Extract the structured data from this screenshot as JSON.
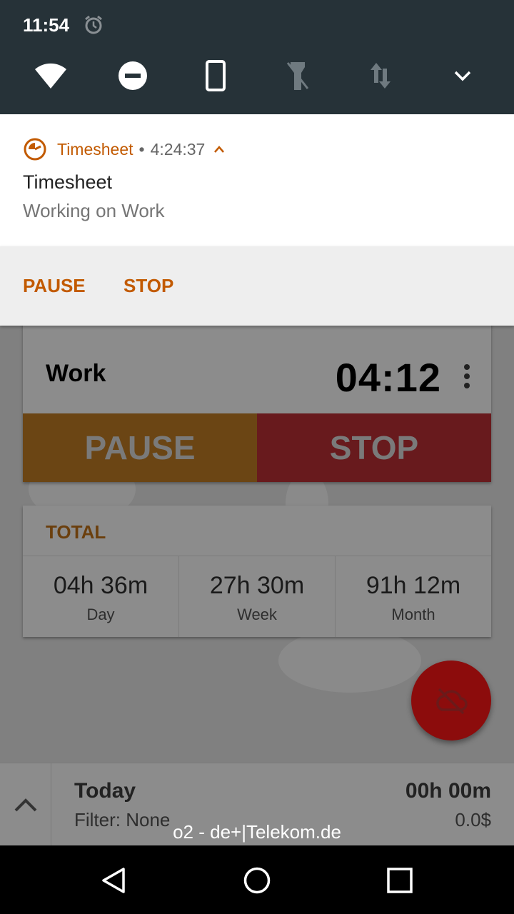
{
  "status_bar": {
    "time": "11:54",
    "icons": [
      "alarm-icon"
    ]
  },
  "quick_settings": {
    "tiles": [
      "wifi-icon",
      "do-not-disturb-icon",
      "auto-rotate-icon",
      "flashlight-off-icon",
      "data-transfer-icon",
      "expand-chevron-icon"
    ]
  },
  "notification": {
    "app_name": "Timesheet",
    "separator": "•",
    "elapsed": "4:24:37",
    "title": "Timesheet",
    "text": "Working on Work",
    "actions": [
      "PAUSE",
      "STOP"
    ]
  },
  "app": {
    "timer": {
      "task": "Work",
      "value": "04:12",
      "pause_label": "PAUSE",
      "stop_label": "STOP"
    },
    "total": {
      "title": "TOTAL",
      "cells": [
        {
          "value": "04h 36m",
          "label": "Day"
        },
        {
          "value": "27h 30m",
          "label": "Week"
        },
        {
          "value": "91h 12m",
          "label": "Month"
        }
      ]
    },
    "bottom": {
      "period": "Today",
      "filter": "Filter: None",
      "total": "00h 00m",
      "money": "0.0$"
    }
  },
  "carrier": "o2 - de+|Telekom.de",
  "colors": {
    "accent": "#c25a00",
    "quick_settings_bg": "#263238",
    "pause": "#6b4514",
    "stop": "#681a1d",
    "fab": "#8c0c0c"
  }
}
